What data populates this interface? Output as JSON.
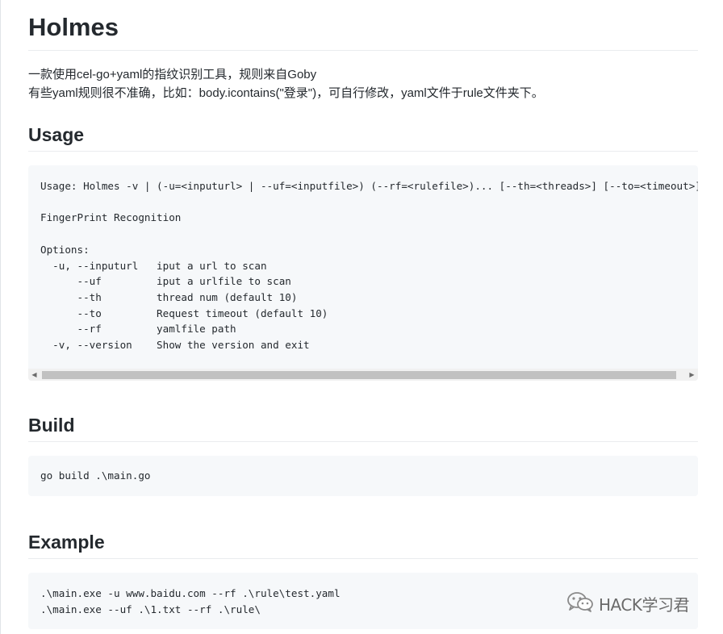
{
  "title": "Holmes",
  "intro": {
    "line1": "一款使用cel-go+yaml的指纹识别工具，规则来自Goby",
    "line2": "有些yaml规则很不准确，比如：body.icontains(\"登录\")，可自行修改，yaml文件于rule文件夹下。"
  },
  "sections": {
    "usage": {
      "heading": "Usage",
      "code": "Usage: Holmes -v | (-u=<inputurl> | --uf=<inputfile>) (--rf=<rulefile>)... [--th=<threads>] [--to=<timeout>]\n\nFingerPrint Recognition\n\nOptions:\n  -u, --inputurl   iput a url to scan\n      --uf         iput a urlfile to scan\n      --th         thread num (default 10)\n      --to         Request timeout (default 10)\n      --rf         yamlfile path\n  -v, --version    Show the version and exit"
    },
    "build": {
      "heading": "Build",
      "code": "go build .\\main.go"
    },
    "example": {
      "heading": "Example",
      "code": ".\\main.exe -u www.baidu.com --rf .\\rule\\test.yaml\n.\\main.exe --uf .\\1.txt --rf .\\rule\\"
    }
  },
  "watermark": {
    "text": "HACK学习君",
    "icon": "wechat-icon"
  }
}
